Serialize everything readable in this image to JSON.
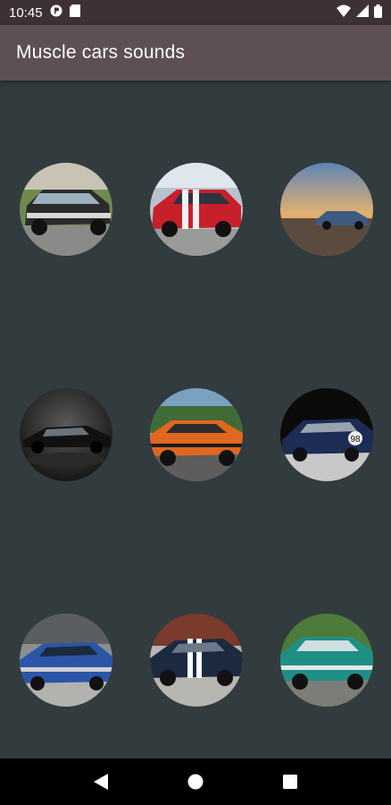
{
  "status_bar": {
    "time": "10:45",
    "icons": [
      "app-notification-icon",
      "sd-card-icon",
      "wifi-icon",
      "signal-icon",
      "battery-icon"
    ]
  },
  "app_bar": {
    "title": "Muscle cars sounds",
    "background": "#5d4f53"
  },
  "colors": {
    "background": "#323b3e",
    "status_bar": "#3d3036",
    "nav_bar": "#000000"
  },
  "cars": [
    {
      "id": "car-1",
      "body": "#2a2a2a",
      "scene": "garden"
    },
    {
      "id": "car-2",
      "body": "#c8202b",
      "scene": "track"
    },
    {
      "id": "car-3",
      "body": "#3d5a80",
      "scene": "sunset"
    },
    {
      "id": "car-4",
      "body": "#111111",
      "scene": "studio"
    },
    {
      "id": "car-5",
      "body": "#e0671f",
      "scene": "palms"
    },
    {
      "id": "car-6",
      "body": "#1d2b55",
      "scene": "dark"
    },
    {
      "id": "car-7",
      "body": "#2b55a8",
      "scene": "trees"
    },
    {
      "id": "car-8",
      "body": "#1c2a40",
      "scene": "garage"
    },
    {
      "id": "car-9",
      "body": "#1f8f86",
      "scene": "park"
    }
  ],
  "nav_bar": {
    "buttons": [
      "back-icon",
      "home-icon",
      "recents-icon"
    ]
  }
}
